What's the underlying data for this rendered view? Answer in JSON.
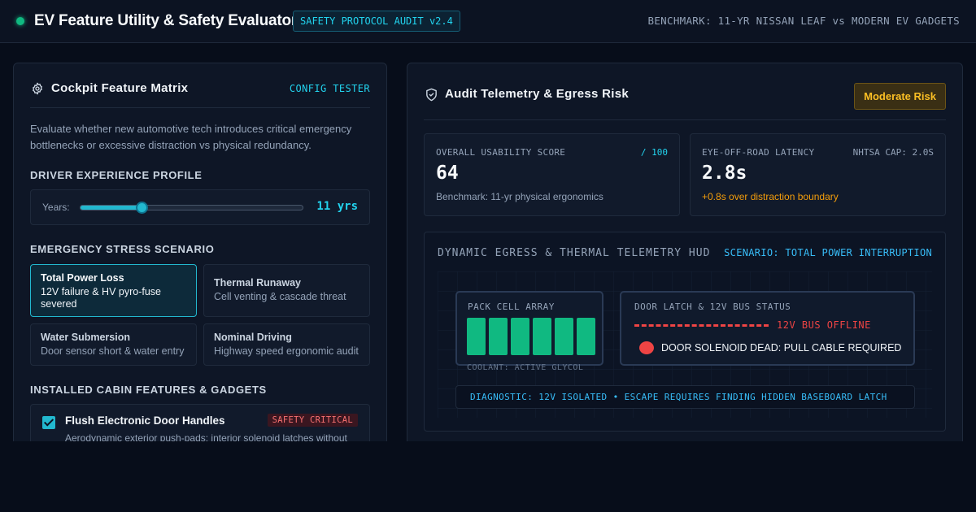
{
  "header": {
    "title": "EV Feature Utility & Safety Evaluator",
    "version_badge": "SAFETY PROTOCOL AUDIT v2.4",
    "benchmark": "BENCHMARK: 11-YR NISSAN LEAF vs MODERN EV GADGETS",
    "status_color": "#10b981"
  },
  "left_panel": {
    "title": "Cockpit Feature Matrix",
    "icon": "gear-icon",
    "config_link": "CONFIG TESTER",
    "description": "Evaluate whether new automotive tech introduces critical emergency bottlenecks or excessive distraction vs physical redundancy.",
    "driver_profile": {
      "section_label": "DRIVER EXPERIENCE PROFILE",
      "slider_label": "Years:",
      "value_text": "11 yrs",
      "value": 11,
      "min": 0,
      "max": 40
    },
    "scenarios": {
      "section_label": "EMERGENCY STRESS SCENARIO",
      "items": [
        {
          "title": "Total Power Loss",
          "desc": "12V failure & HV pyro-fuse severed",
          "active": true
        },
        {
          "title": "Thermal Runaway",
          "desc": "Cell venting & cascade threat",
          "active": false
        },
        {
          "title": "Water Submersion",
          "desc": "Door sensor short & water entry",
          "active": false
        },
        {
          "title": "Nominal Driving",
          "desc": "Highway speed ergonomic audit",
          "active": false
        }
      ]
    },
    "features": {
      "section_label": "INSTALLED CABIN FEATURES & GADGETS",
      "items": [
        {
          "name": "Flush Electronic Door Handles",
          "badge": "SAFETY CRITICAL",
          "desc": "Aerodynamic exterior push-pads; interior solenoid latches without",
          "checked": true
        }
      ]
    }
  },
  "right_panel": {
    "title": "Audit Telemetry & Egress Risk",
    "icon": "shield-check-icon",
    "risk_badge": "Moderate Risk",
    "usability": {
      "label": "OVERALL USABILITY SCORE",
      "max_label": "/ 100",
      "value": "64",
      "foot": "Benchmark: 11-yr physical ergonomics"
    },
    "latency": {
      "label": "EYE-OFF-ROAD LATENCY",
      "cap": "NHTSA CAP: 2.0S",
      "value": "2.8s",
      "foot": "+0.8s over distraction boundary",
      "foot_color": "#f59e0b"
    },
    "hud": {
      "title": "DYNAMIC EGRESS & THERMAL TELEMETRY HUD",
      "scenario": "SCENARIO: TOTAL POWER INTERRUPTION",
      "pack_label": "PACK CELL ARRAY",
      "cell_count": 6,
      "cell_color": "#10b981",
      "coolant": "COOLANT: ACTIVE GLYCOL",
      "door_label": "DOOR LATCH & 12V BUS STATUS",
      "bus_status": "12V BUS OFFLINE",
      "solenoid": "DOOR SOLENOID DEAD: PULL CABLE REQUIRED",
      "diagnostic": "DIAGNOSTIC: 12V ISOLATED • ESCAPE REQUIRES FINDING HIDDEN BASEBOARD LATCH"
    }
  }
}
